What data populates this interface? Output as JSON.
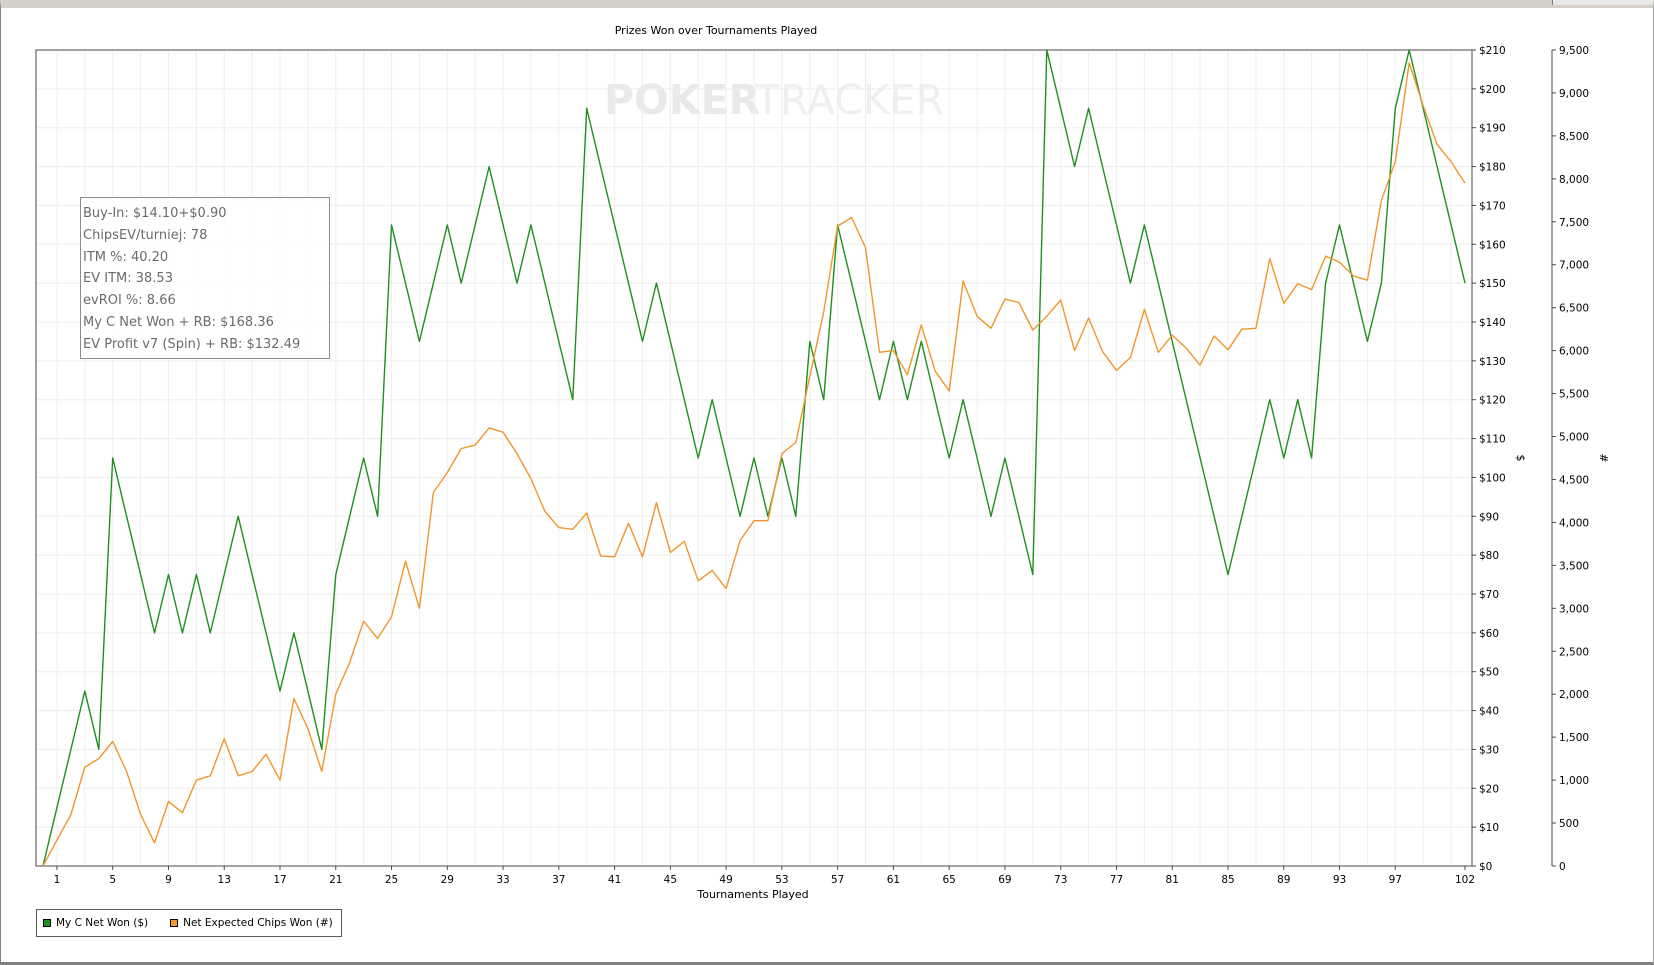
{
  "watermark": {
    "part1": "POKER",
    "part2": "TRACKER"
  },
  "stats_box": {
    "lines": [
      "Buy-In: $14.10+$0.90",
      "ChipsEV/turniej: 78",
      "ITM %: 40.20",
      "EV ITM: 38.53",
      "evROI %: 8.66",
      "My C Net Won + RB: $168.36",
      "EV Profit v7 (Spin) + RB: $132.49"
    ]
  },
  "chart_data": {
    "type": "line",
    "title": "Prizes Won over Tournaments Played",
    "xlabel": "Tournaments Played",
    "ylabel_left": "",
    "ylabel_right_dollar": "$",
    "ylabel_right_chips": "#",
    "xlim": [
      0,
      102
    ],
    "x_ticks": [
      1,
      5,
      9,
      13,
      17,
      21,
      25,
      29,
      33,
      37,
      41,
      45,
      49,
      53,
      57,
      61,
      65,
      69,
      73,
      77,
      81,
      85,
      89,
      93,
      97,
      102
    ],
    "y_dollar_lim": [
      0,
      210
    ],
    "y_dollar_ticks": [
      0,
      10,
      20,
      30,
      40,
      50,
      60,
      70,
      80,
      90,
      100,
      110,
      120,
      130,
      140,
      150,
      160,
      170,
      180,
      190,
      200,
      210
    ],
    "y_dollar_tick_labels": [
      "$0",
      "$10",
      "$20",
      "$30",
      "$40",
      "$50",
      "$60",
      "$70",
      "$80",
      "$90",
      "$100",
      "$110",
      "$120",
      "$130",
      "$140",
      "$150",
      "$160",
      "$170",
      "$180",
      "$190",
      "$200",
      "$210"
    ],
    "y_chips_lim": [
      0,
      9500
    ],
    "y_chips_ticks": [
      0,
      500,
      1000,
      1500,
      2000,
      2500,
      3000,
      3500,
      4000,
      4500,
      5000,
      5500,
      6000,
      6500,
      7000,
      7500,
      8000,
      8500,
      9000,
      9500
    ],
    "y_chips_tick_labels": [
      "0",
      "500",
      "1,000",
      "1,500",
      "2,000",
      "2,500",
      "3,000",
      "3,500",
      "4,000",
      "4,500",
      "5,000",
      "5,500",
      "6,000",
      "6,500",
      "7,000",
      "7,500",
      "8,000",
      "8,500",
      "9,000",
      "9,500"
    ],
    "grid": true,
    "legend_position": "bottom-left",
    "series": [
      {
        "name": "My C Net Won ($)",
        "color": "#1f8f1f",
        "axis": "dollar",
        "x": [
          0,
          1,
          2,
          3,
          4,
          5,
          6,
          7,
          8,
          9,
          10,
          11,
          12,
          13,
          14,
          15,
          16,
          17,
          18,
          19,
          20,
          21,
          22,
          23,
          24,
          25,
          26,
          27,
          28,
          29,
          30,
          31,
          32,
          33,
          34,
          35,
          36,
          37,
          38,
          39,
          40,
          41,
          42,
          43,
          44,
          45,
          46,
          47,
          48,
          49,
          50,
          51,
          52,
          53,
          54,
          55,
          56,
          57,
          58,
          59,
          60,
          61,
          62,
          63,
          64,
          65,
          66,
          67,
          68,
          69,
          70,
          71,
          72,
          73,
          74,
          75,
          76,
          77,
          78,
          79,
          80,
          81,
          82,
          83,
          84,
          85,
          86,
          87,
          88,
          89,
          90,
          91,
          92,
          93,
          94,
          95,
          96,
          97,
          98,
          99,
          100,
          101,
          102
        ],
        "values": [
          0,
          15,
          30,
          45,
          30,
          105,
          90,
          75,
          60,
          75,
          60,
          75,
          60,
          75,
          90,
          75,
          60,
          45,
          60,
          45,
          30,
          75,
          90,
          105,
          90,
          165,
          150,
          135,
          150,
          165,
          150,
          165,
          180,
          165,
          150,
          165,
          150,
          135,
          120,
          195,
          180,
          165,
          150,
          135,
          150,
          135,
          120,
          105,
          120,
          105,
          90,
          105,
          90,
          105,
          90,
          135,
          120,
          165,
          150,
          135,
          120,
          135,
          120,
          135,
          120,
          105,
          120,
          105,
          90,
          105,
          90,
          75,
          210,
          195,
          180,
          195,
          180,
          165,
          150,
          165,
          150,
          135,
          120,
          105,
          90,
          75,
          90,
          105,
          120,
          105,
          120,
          105,
          150,
          165,
          150,
          135,
          150,
          195,
          210,
          195,
          180,
          165,
          150
        ]
      },
      {
        "name": "Net Expected Chips Won (#)",
        "color": "#f0962d",
        "axis": "chips",
        "x": [
          0,
          1,
          2,
          3,
          4,
          5,
          6,
          7,
          8,
          9,
          10,
          11,
          12,
          13,
          14,
          15,
          16,
          17,
          18,
          19,
          20,
          21,
          22,
          23,
          24,
          25,
          26,
          27,
          28,
          29,
          30,
          31,
          32,
          33,
          34,
          35,
          36,
          37,
          38,
          39,
          40,
          41,
          42,
          43,
          44,
          45,
          46,
          47,
          48,
          49,
          50,
          51,
          52,
          53,
          54,
          55,
          56,
          57,
          58,
          59,
          60,
          61,
          62,
          63,
          64,
          65,
          66,
          67,
          68,
          69,
          70,
          71,
          72,
          73,
          74,
          75,
          76,
          77,
          78,
          79,
          80,
          81,
          82,
          83,
          84,
          85,
          86,
          87,
          88,
          89,
          90,
          91,
          92,
          93,
          94,
          95,
          96,
          97,
          98,
          99,
          100,
          101,
          102
        ],
        "values": [
          0,
          300,
          600,
          1150,
          1250,
          1450,
          1100,
          600,
          270,
          750,
          620,
          1000,
          1050,
          1480,
          1050,
          1100,
          1300,
          1000,
          1950,
          1600,
          1100,
          2000,
          2370,
          2850,
          2650,
          2900,
          3550,
          3000,
          4350,
          4580,
          4860,
          4900,
          5100,
          5050,
          4800,
          4510,
          4130,
          3940,
          3920,
          4110,
          3610,
          3600,
          3990,
          3600,
          4230,
          3650,
          3780,
          3320,
          3440,
          3230,
          3790,
          4020,
          4020,
          4800,
          4930,
          5700,
          6450,
          7450,
          7550,
          7200,
          5980,
          6000,
          5720,
          6300,
          5760,
          5530,
          6810,
          6400,
          6260,
          6600,
          6560,
          6240,
          6400,
          6590,
          6000,
          6380,
          5990,
          5770,
          5920,
          6480,
          5980,
          6180,
          6030,
          5830,
          6170,
          6010,
          6250,
          6260,
          7070,
          6550,
          6780,
          6710,
          7100,
          7030,
          6870,
          6820,
          7750,
          8200,
          9350,
          8850,
          8400,
          8200,
          7950
        ]
      }
    ]
  }
}
